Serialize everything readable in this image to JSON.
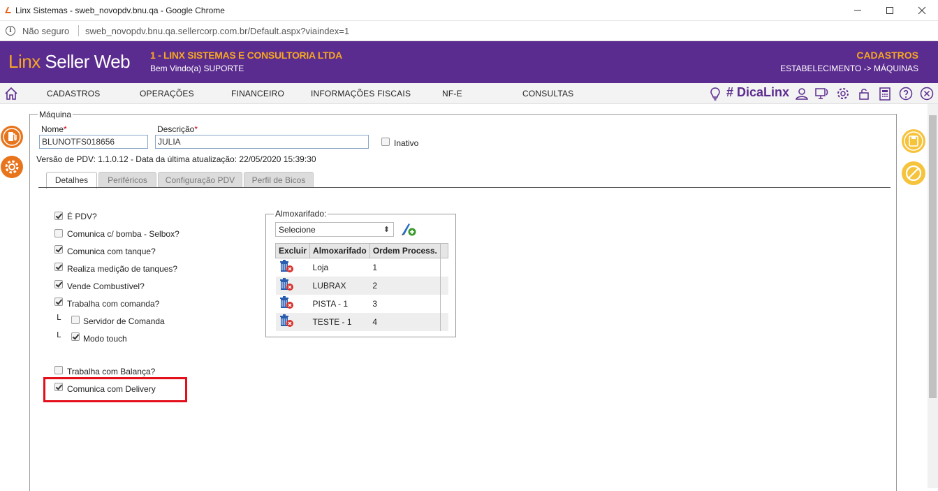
{
  "browser": {
    "window_title": "Linx Sistemas - sweb_novopdv.bnu.qa - Google Chrome",
    "security_label": "Não seguro",
    "url": "sweb_novopdv.bnu.qa.sellercorp.com.br/Default.aspx?viaindex=1"
  },
  "header": {
    "brand_accent": "Linx",
    "brand_rest": " Seller Web",
    "company": "1 - LINX SISTEMAS E CONSULTORIA LTDA",
    "welcome": "Bem Vindo(a) SUPORTE",
    "section_title": "CADASTROS",
    "section_path": "ESTABELECIMENTO -> MÁQUINAS",
    "colors": {
      "purple": "#5b2c8f",
      "orange": "#f5a623"
    }
  },
  "nav": {
    "items": [
      "CADASTROS",
      "OPERAÇÕES",
      "FINANCEIRO",
      "INFORMAÇÕES FISCAIS",
      "NF-E",
      "CONSULTAS"
    ],
    "dicalinx": "# DicaLinx",
    "icons": [
      "home-icon",
      "lightbulb-icon",
      "user-icon",
      "monitor-icon",
      "gear-icon",
      "lock-icon",
      "calculator-icon",
      "help-icon",
      "close-icon"
    ]
  },
  "form": {
    "legend": "Máquina",
    "nome_label": "Nome",
    "nome_value": "BLUNOTFS018656",
    "descricao_label": "Descrição",
    "descricao_value": "JULIA",
    "required_mark": "*",
    "inativo_label": "Inativo",
    "version_info": "Versão de PDV: 1.1.0.12 - Data da última atualização: 22/05/2020 15:39:30"
  },
  "tabs": [
    "Detalhes",
    "Periféricos",
    "Configuração PDV",
    "Perfil de Bicos"
  ],
  "options": {
    "e_pdv": "É PDV?",
    "bomba": "Comunica c/ bomba - Selbox?",
    "tanque": "Comunica com tanque?",
    "medicao": "Realiza medição de tanques?",
    "combustivel": "Vende Combustível?",
    "comanda": "Trabalha com comanda?",
    "servidor_comanda": "Servidor de Comanda",
    "modo_touch": "Modo touch",
    "balanca": "Trabalha com Balança?",
    "delivery": "Comunica com Delivery",
    "tree_mark": "L"
  },
  "almoxarifado": {
    "legend": "Almoxarifado:",
    "select_value": "Selecione",
    "headers": [
      "Excluir",
      "Almoxarifado",
      "Ordem Process."
    ],
    "rows": [
      {
        "name": "Loja",
        "order": "1"
      },
      {
        "name": "LUBRAX",
        "order": "2"
      },
      {
        "name": "PISTA - 1",
        "order": "3"
      },
      {
        "name": "TESTE - 1",
        "order": "4"
      }
    ]
  }
}
